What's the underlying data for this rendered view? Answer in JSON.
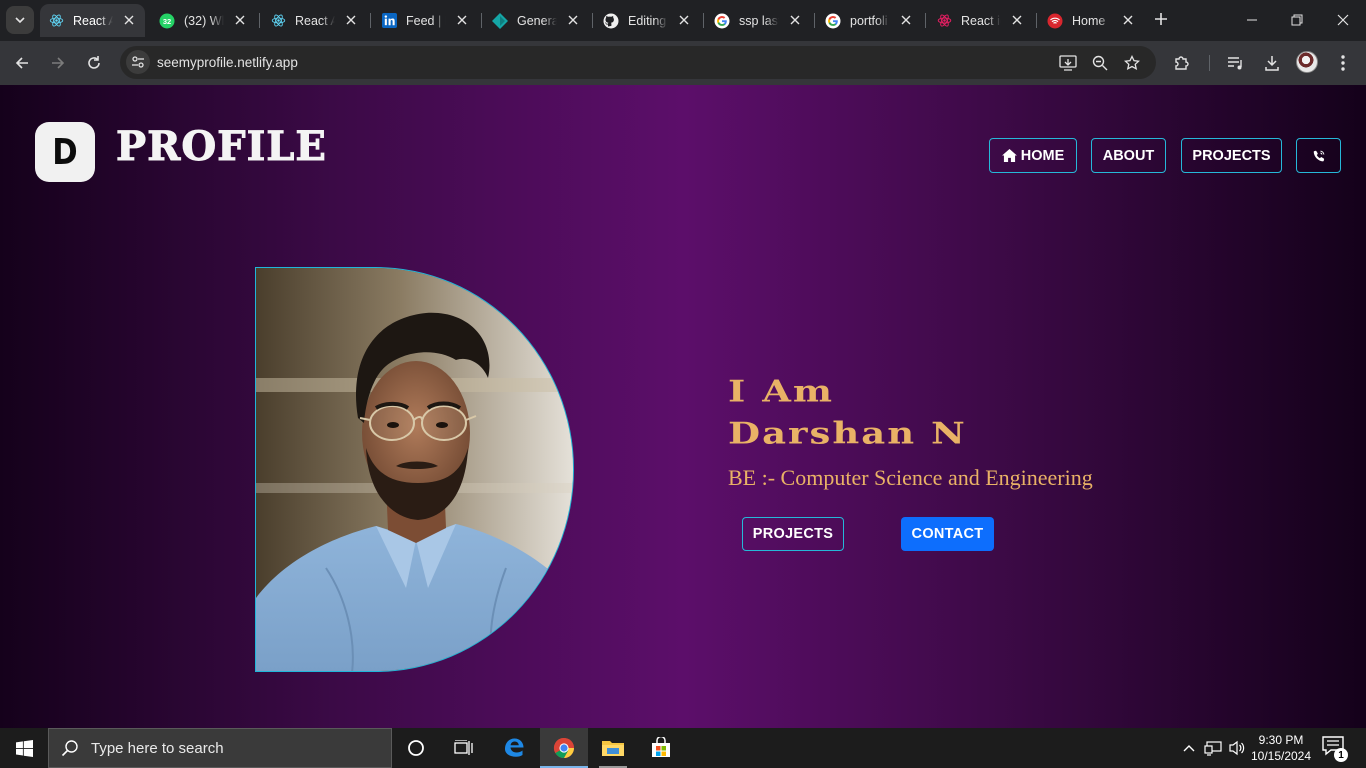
{
  "browser": {
    "tabs": [
      {
        "title": "React A",
        "icon": "react-icon",
        "active": true
      },
      {
        "title": "(32) Wh",
        "icon": "whatsapp-icon"
      },
      {
        "title": "React A",
        "icon": "react-icon"
      },
      {
        "title": "Feed | L",
        "icon": "linkedin-icon"
      },
      {
        "title": "Generat",
        "icon": "diamond-icon"
      },
      {
        "title": "Editing",
        "icon": "github-icon"
      },
      {
        "title": "ssp last",
        "icon": "google-icon"
      },
      {
        "title": "portfoli",
        "icon": "google-icon"
      },
      {
        "title": "React ic",
        "icon": "react-icons-icon"
      },
      {
        "title": "Home",
        "icon": "wifi-icon"
      }
    ],
    "address": "seemyprofile.netlify.app",
    "whatsapp_badge": "32"
  },
  "page": {
    "logo_letter": "D",
    "logo_text": "PROFILE",
    "nav": {
      "home": "HOME",
      "about": "ABOUT",
      "projects": "PROJECTS",
      "contact_icon": "phone-icon"
    },
    "hero": {
      "line1": "I Am",
      "line2": "Darshan N",
      "subtitle": "BE :- Computer Science and Engineering",
      "projects_button": "PROJECTS",
      "contact_button": "CONTACT"
    },
    "colors": {
      "accent_gold": "#e9b266",
      "border_cyan": "#26b8d8",
      "primary_blue": "#0d6efd",
      "background_purple": "#5c0e6a"
    }
  },
  "taskbar": {
    "search_placeholder": "Type here to search",
    "time": "9:30 PM",
    "date": "10/15/2024",
    "notification_count": "1"
  }
}
